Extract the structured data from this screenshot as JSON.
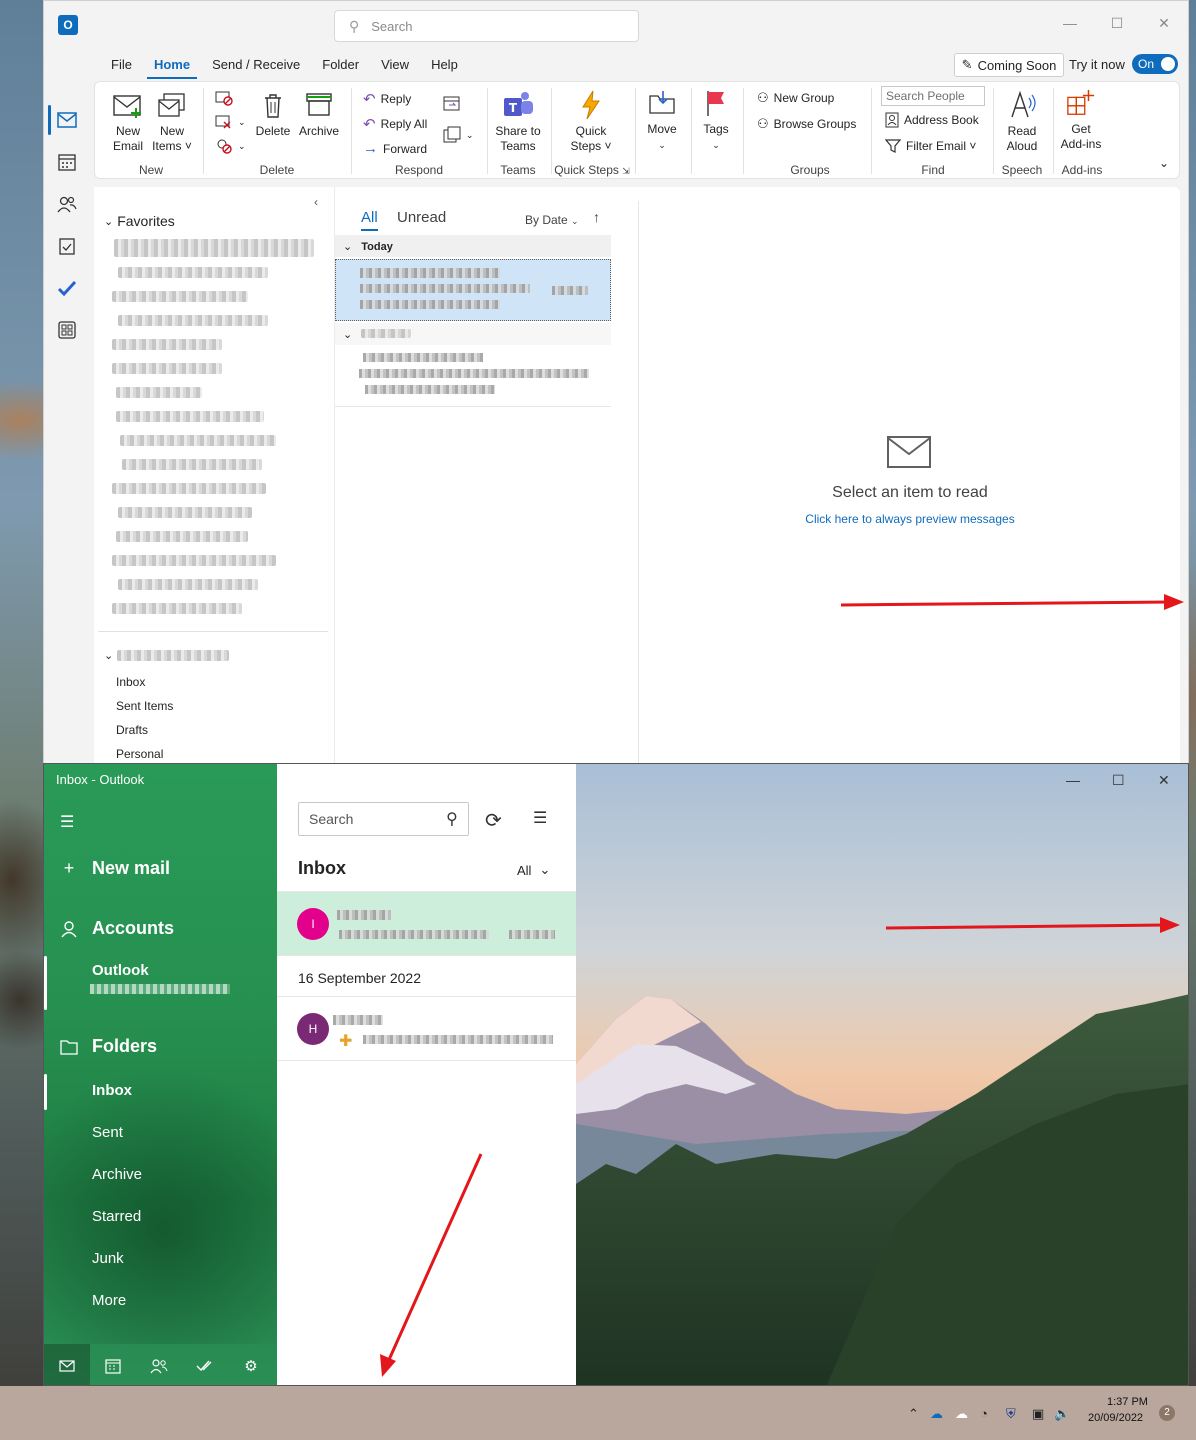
{
  "classic": {
    "search_placeholder": "Search",
    "menu": [
      "File",
      "Home",
      "Send / Receive",
      "Folder",
      "View",
      "Help"
    ],
    "coming_soon": "Coming Soon",
    "try_it_now": "Try it now",
    "toggle": "On",
    "ribbon": {
      "new_email_1": "New",
      "new_email_2": "Email",
      "new_items_1": "New",
      "new_items_2": "Items ˅",
      "delete": "Delete",
      "archive": "Archive",
      "reply": "Reply",
      "reply_all": "Reply All",
      "forward": "Forward",
      "share_teams_1": "Share to",
      "share_teams_2": "Teams",
      "quick_steps_1": "Quick",
      "quick_steps_2": "Steps ˅",
      "move": "Move",
      "tags": "Tags",
      "new_group": "New Group",
      "browse_groups": "Browse Groups",
      "search_people": "Search People",
      "address_book": "Address Book",
      "filter_email": "Filter Email ˅",
      "read_aloud_1": "Read",
      "read_aloud_2": "Aloud",
      "get_addins_1": "Get",
      "get_addins_2": "Add-ins",
      "groups": [
        "New",
        "Delete",
        "Respond",
        "Teams",
        "Quick Steps",
        "Groups",
        "Find",
        "Speech",
        "Add-ins"
      ]
    },
    "folders": {
      "favorites": "Favorites",
      "items": [
        "Inbox",
        "Sent Items",
        "Drafts",
        "Personal"
      ]
    },
    "list": {
      "tab_all": "All",
      "tab_unread": "Unread",
      "sort": "By Date",
      "group_today": "Today"
    },
    "reading": {
      "empty_title": "Select an item to read",
      "preview_link": "Click here to always preview messages"
    }
  },
  "mail": {
    "title": "Inbox - Outlook",
    "new_mail": "New mail",
    "accounts": "Accounts",
    "account_name": "Outlook",
    "folders_label": "Folders",
    "folders": [
      "Inbox",
      "Sent",
      "Archive",
      "Starred",
      "Junk",
      "More"
    ],
    "search_placeholder": "Search",
    "inbox_title": "Inbox",
    "filter": "All",
    "date_header": "16 September 2022",
    "avatars": [
      {
        "letter": "I",
        "color": "#e3008c"
      },
      {
        "letter": "H",
        "color": "#7a2a74"
      }
    ]
  },
  "taskbar": {
    "time": "1:37 PM",
    "date": "20/09/2022",
    "notifications": "2"
  },
  "colors": {
    "accent": "#0f6cbd",
    "mail_green": "#2a9a58",
    "annotation_red": "#e3161b"
  }
}
